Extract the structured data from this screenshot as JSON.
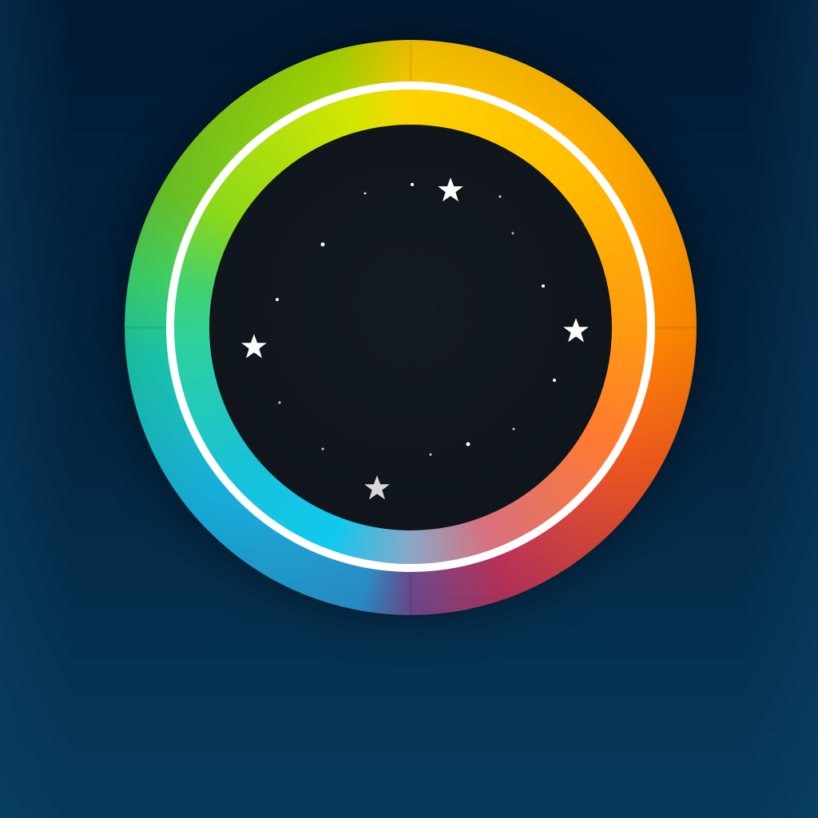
{
  "scene": {
    "background_colors": [
      "#021a33",
      "#063a5c"
    ],
    "wheel_colors": [
      "#f6c400",
      "#ff8a00",
      "#f25a1e",
      "#6c4a8e",
      "#17b0dd",
      "#3ccf6a",
      "#a6d400"
    ],
    "ring_color": "#ffffff",
    "center_color": "#12171e"
  },
  "stars": [
    {
      "name": "star-top",
      "icon": "star-icon",
      "color": "#ffffff"
    },
    {
      "name": "star-right",
      "icon": "star-icon",
      "color": "#ffffff"
    },
    {
      "name": "star-left",
      "icon": "star-icon",
      "color": "#ffffff"
    },
    {
      "name": "star-bottom",
      "icon": "star-icon",
      "color": "#d8d8d8"
    }
  ]
}
